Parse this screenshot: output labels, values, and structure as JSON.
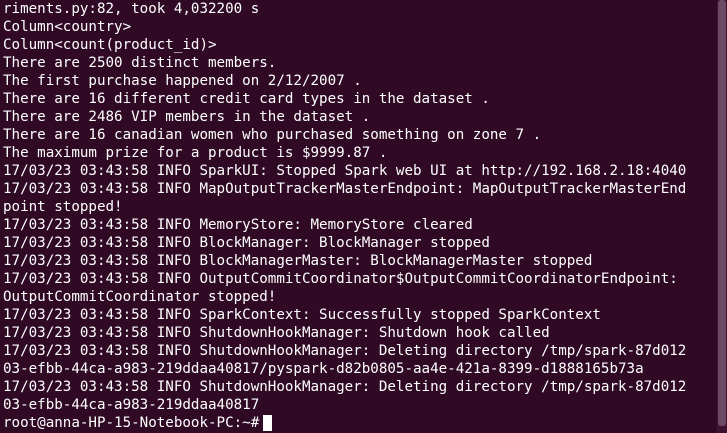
{
  "terminal": {
    "lines": [
      "riments.py:82, took 4,032200 s",
      "Column<country>",
      "Column<count(product_id)>",
      "There are 2500 distinct members.",
      "The first purchase happened on 2/12/2007 .",
      "There are 16 different credit card types in the dataset .",
      "There are 2486 VIP members in the dataset .",
      "There are 16 canadian women who purchased something on zone 7 .",
      "The maximum prize for a product is $9999.87 .",
      "17/03/23 03:43:58 INFO SparkUI: Stopped Spark web UI at http://192.168.2.18:4040",
      "17/03/23 03:43:58 INFO MapOutputTrackerMasterEndpoint: MapOutputTrackerMasterEnd",
      "point stopped!",
      "17/03/23 03:43:58 INFO MemoryStore: MemoryStore cleared",
      "17/03/23 03:43:58 INFO BlockManager: BlockManager stopped",
      "17/03/23 03:43:58 INFO BlockManagerMaster: BlockManagerMaster stopped",
      "17/03/23 03:43:58 INFO OutputCommitCoordinator$OutputCommitCoordinatorEndpoint:",
      "OutputCommitCoordinator stopped!",
      "17/03/23 03:43:58 INFO SparkContext: Successfully stopped SparkContext",
      "17/03/23 03:43:58 INFO ShutdownHookManager: Shutdown hook called",
      "17/03/23 03:43:58 INFO ShutdownHookManager: Deleting directory /tmp/spark-87d012",
      "03-efbb-44ca-a983-219ddaa40817/pyspark-d82b0805-aa4e-421a-8399-d1888165b73a",
      "17/03/23 03:43:58 INFO ShutdownHookManager: Deleting directory /tmp/spark-87d012",
      "03-efbb-44ca-a983-219ddaa40817"
    ],
    "prompt": "root@anna-HP-15-Notebook-PC:~#"
  },
  "colors": {
    "background": "#300a24",
    "foreground": "#ffffff"
  }
}
